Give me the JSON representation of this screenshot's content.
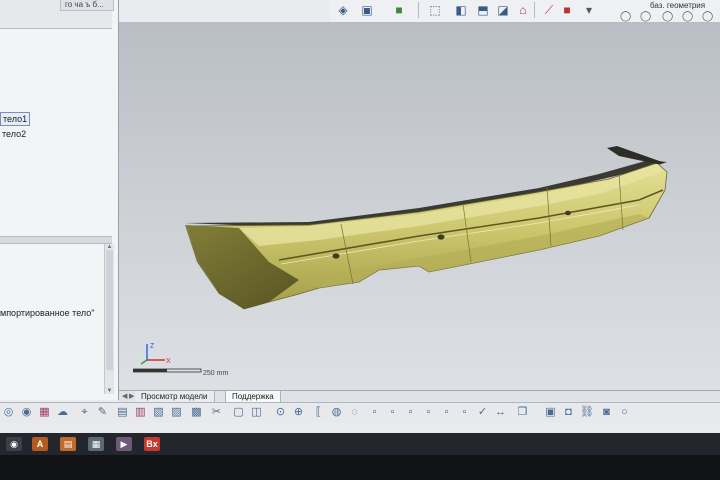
{
  "left_panel": {
    "tab_label": "го ча ъ б...",
    "tree_items": [
      "тело1",
      "тело2"
    ],
    "import_label": "мпортированное тело\""
  },
  "top_toolbar": {
    "geometry_label": "баз. геометрия",
    "icons": [
      "view-cube-icon",
      "box-icon",
      "color-cube-icon",
      "front-view-icon",
      "left-view-icon",
      "top-view-icon",
      "iso-view-icon",
      "home-view-icon",
      "line-tool-icon",
      "red-square-icon"
    ]
  },
  "viewport": {
    "scale_label": "250 mm",
    "axis_labels": [
      "Z",
      "X"
    ]
  },
  "view_tabs": [
    {
      "label": "Просмотр модели"
    },
    {
      "label": "Поддержка"
    }
  ],
  "taskbar_apps": [
    {
      "name": "windows-start-icon",
      "color": "#3a3f48"
    },
    {
      "name": "adobe-app-icon",
      "color": "#b35a1e"
    },
    {
      "name": "document-app-icon",
      "color": "#c46a2a"
    },
    {
      "name": "image-app-icon",
      "color": "#5a6b78"
    },
    {
      "name": "media-app-icon",
      "color": "#6e5a78"
    },
    {
      "name": "bx-app-icon",
      "color": "#c23a2e",
      "label": "Bx"
    }
  ],
  "colors": {
    "part_fill": "#c8c46a",
    "part_shadow": "#6e6a2c",
    "viewport_bg": "#c4c8cd"
  }
}
